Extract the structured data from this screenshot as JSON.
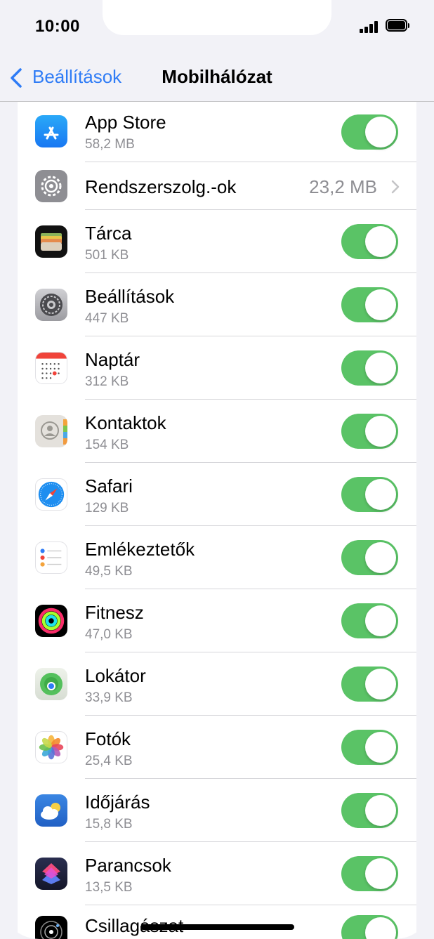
{
  "status_bar": {
    "time": "10:00"
  },
  "nav": {
    "back_label": "Beállítások",
    "title": "Mobilhálózat"
  },
  "rows": [
    {
      "name": "App Store",
      "size": "58,2 MB",
      "toggle_on": true,
      "icon": "app-store-icon"
    },
    {
      "name": "Rendszerszolg.-ok",
      "value": "23,2 MB",
      "icon": "gear-icon"
    },
    {
      "name": "Tárca",
      "size": "501 KB",
      "toggle_on": true,
      "icon": "wallet-icon"
    },
    {
      "name": "Beállítások",
      "size": "447 KB",
      "toggle_on": true,
      "icon": "settings-icon"
    },
    {
      "name": "Naptár",
      "size": "312 KB",
      "toggle_on": true,
      "icon": "calendar-icon"
    },
    {
      "name": "Kontaktok",
      "size": "154 KB",
      "toggle_on": true,
      "icon": "contacts-icon"
    },
    {
      "name": "Safari",
      "size": "129 KB",
      "toggle_on": true,
      "icon": "safari-icon"
    },
    {
      "name": "Emlékeztetők",
      "size": "49,5 KB",
      "toggle_on": true,
      "icon": "reminders-icon"
    },
    {
      "name": "Fitnesz",
      "size": "47,0 KB",
      "toggle_on": true,
      "icon": "fitness-icon"
    },
    {
      "name": "Lokátor",
      "size": "33,9 KB",
      "toggle_on": true,
      "icon": "find-my-icon"
    },
    {
      "name": "Fotók",
      "size": "25,4 KB",
      "toggle_on": true,
      "icon": "photos-icon"
    },
    {
      "name": "Időjárás",
      "size": "15,8 KB",
      "toggle_on": true,
      "icon": "weather-icon"
    },
    {
      "name": "Parancsok",
      "size": "13,5 KB",
      "toggle_on": true,
      "icon": "shortcuts-icon"
    },
    {
      "name": "Csillagászat",
      "toggle_on": true,
      "icon": "astronomy-icon"
    }
  ],
  "colors": {
    "accent": "#2f7cf6",
    "toggle_on": "#5ac366",
    "secondary_text": "#8e8e93"
  }
}
